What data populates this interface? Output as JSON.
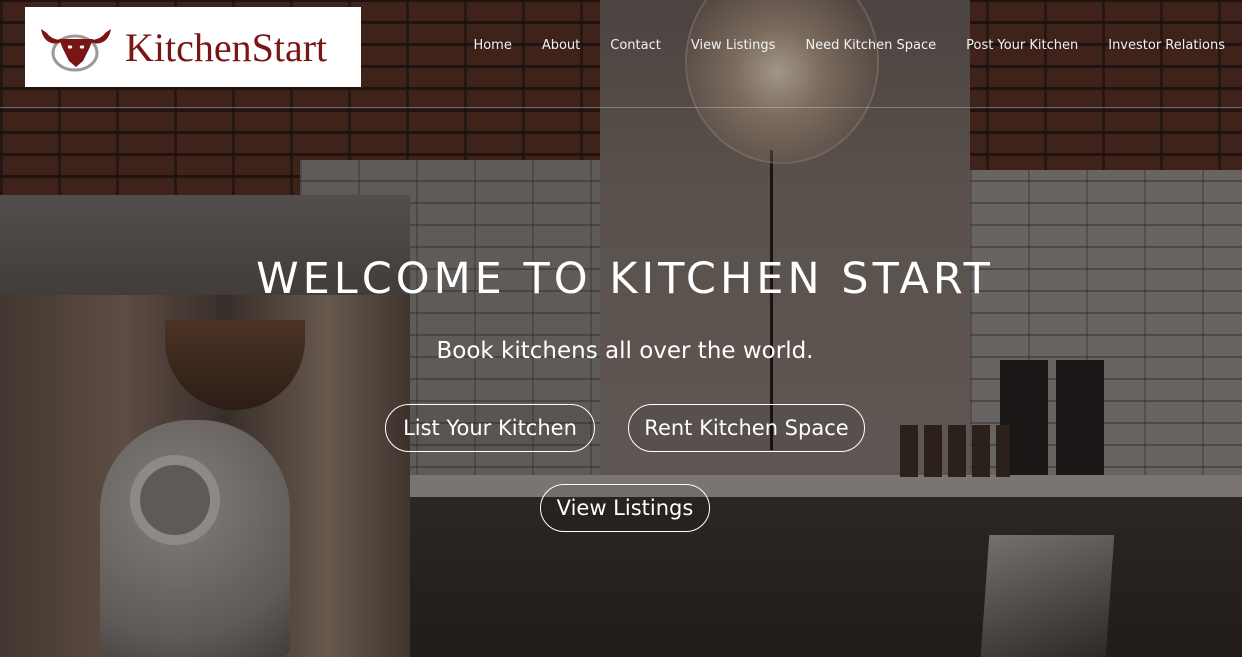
{
  "brand": {
    "name": "KitchenStart",
    "logo_icon": "bull-head-icon",
    "colors": {
      "logo_red": "#7a1515",
      "logo_grey": "#9a9a9a"
    }
  },
  "nav": {
    "items": [
      {
        "label": "Home"
      },
      {
        "label": "About"
      },
      {
        "label": "Contact"
      },
      {
        "label": "View Listings"
      },
      {
        "label": "Need Kitchen Space"
      },
      {
        "label": "Post Your Kitchen"
      },
      {
        "label": "Investor Relations"
      }
    ]
  },
  "hero": {
    "title": "WELCOME TO KITCHEN START",
    "subtitle": "Book kitchens all over the world.",
    "buttons": {
      "list_kitchen": "List Your Kitchen",
      "rent_space": "Rent Kitchen Space",
      "view_listings": "View Listings"
    }
  }
}
